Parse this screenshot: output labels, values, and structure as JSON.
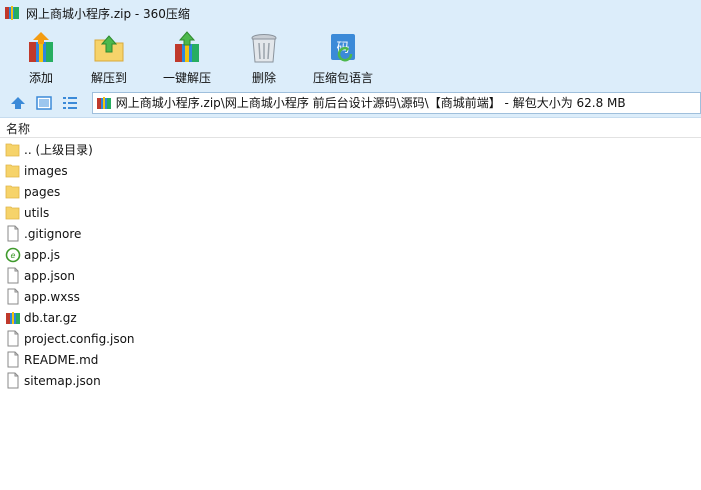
{
  "window": {
    "title": "网上商城小程序.zip - 360压缩"
  },
  "toolbar": {
    "items": [
      {
        "label": "添加",
        "icon": "add-archive-icon"
      },
      {
        "label": "解压到",
        "icon": "extract-to-icon"
      },
      {
        "label": "一键解压",
        "icon": "one-click-extract-icon"
      },
      {
        "label": "删除",
        "icon": "delete-trash-icon"
      },
      {
        "label": "压缩包语言",
        "icon": "archive-language-icon"
      }
    ]
  },
  "navbar": {
    "path": "网上商城小程序.zip\\网上商城小程序 前后台设计源码\\源码\\【商城前端】 - 解包大小为 62.8 MB"
  },
  "list": {
    "column_name": "名称",
    "files": [
      {
        "name": ".. (上级目录)",
        "type": "folder"
      },
      {
        "name": "images",
        "type": "folder"
      },
      {
        "name": "pages",
        "type": "folder"
      },
      {
        "name": "utils",
        "type": "folder"
      },
      {
        "name": ".gitignore",
        "type": "file"
      },
      {
        "name": "app.js",
        "type": "js"
      },
      {
        "name": "app.json",
        "type": "file"
      },
      {
        "name": "app.wxss",
        "type": "file"
      },
      {
        "name": "db.tar.gz",
        "type": "archive"
      },
      {
        "name": "project.config.json",
        "type": "file"
      },
      {
        "name": "README.md",
        "type": "file"
      },
      {
        "name": "sitemap.json",
        "type": "file"
      }
    ]
  },
  "colors": {
    "chrome_bg": "#dcedfa",
    "folder": "#f6d36a",
    "nav_blue": "#3b8ad8",
    "js_green": "#3f9a2c"
  }
}
